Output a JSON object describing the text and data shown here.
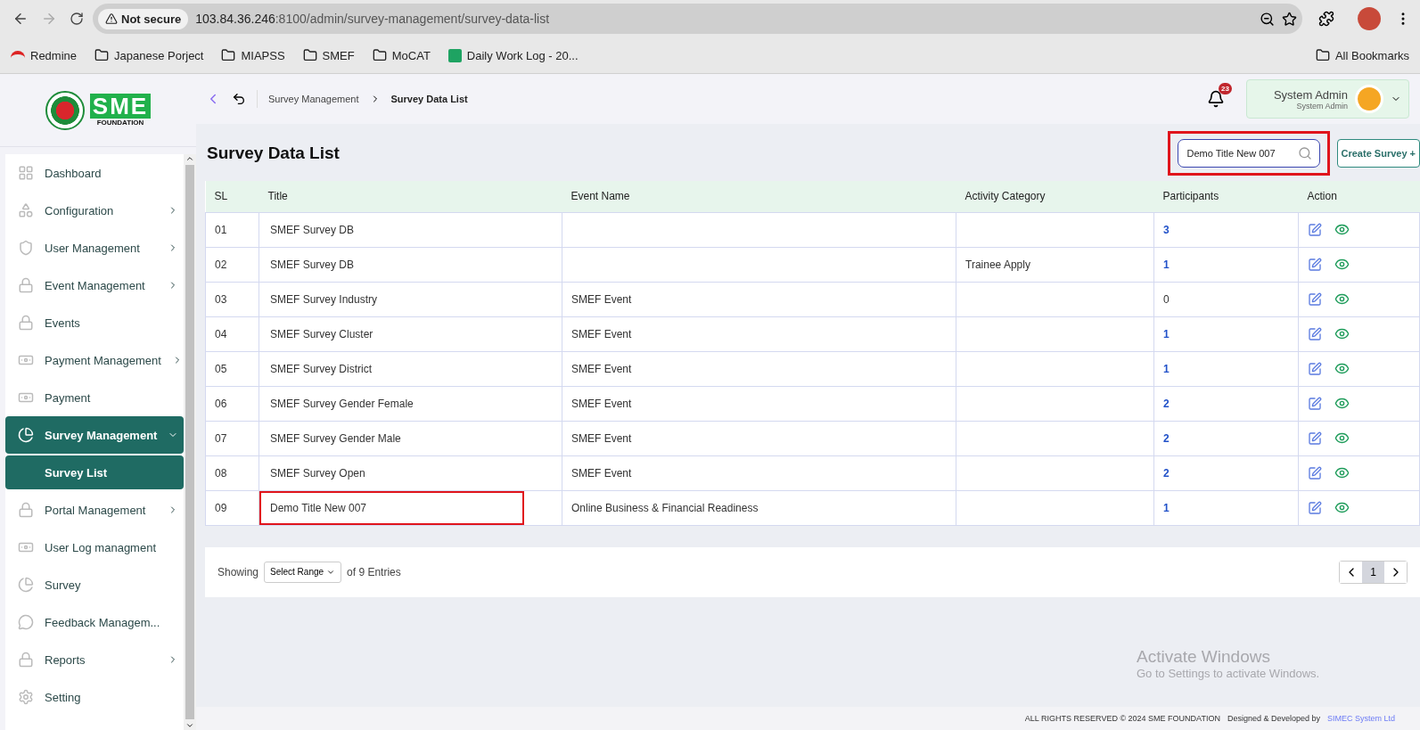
{
  "browser": {
    "security": "Not secure",
    "url_host": "103.84.36.246",
    "url_path": ":8100/admin/survey-management/survey-data-list",
    "bookmarks": [
      {
        "label": "Redmine",
        "kind": "site"
      },
      {
        "label": "Japanese Porject",
        "kind": "folder"
      },
      {
        "label": "MIAPSS",
        "kind": "folder"
      },
      {
        "label": "SMEF",
        "kind": "folder"
      },
      {
        "label": "MoCAT",
        "kind": "folder"
      },
      {
        "label": "Daily Work Log - 20...",
        "kind": "sheet"
      }
    ],
    "all_bookmarks": "All Bookmarks"
  },
  "logo": {
    "text": "SME",
    "subtitle": "FOUNDATION"
  },
  "breadcrumb": [
    {
      "label": "Survey Management",
      "current": false
    },
    {
      "label": "Survey Data List",
      "current": true
    }
  ],
  "notifications": {
    "count": "23"
  },
  "user": {
    "name": "System Admin",
    "role": "System Admin"
  },
  "sidebar": {
    "items": [
      {
        "label": "Dashboard",
        "has_submenu": false,
        "selected": false
      },
      {
        "label": "Configuration",
        "has_submenu": true,
        "selected": false,
        "expanded": false
      },
      {
        "label": "User Management",
        "has_submenu": true,
        "selected": false,
        "expanded": false
      },
      {
        "label": "Event Management",
        "has_submenu": true,
        "selected": false,
        "expanded": false
      },
      {
        "label": "Events",
        "has_submenu": false,
        "selected": false
      },
      {
        "label": "Payment Management",
        "has_submenu": true,
        "selected": false,
        "expanded": false
      },
      {
        "label": "Payment",
        "has_submenu": false,
        "selected": false
      },
      {
        "label": "Survey Management",
        "has_submenu": true,
        "selected": true,
        "expanded": true,
        "children": [
          {
            "label": "Survey List",
            "selected": true
          }
        ]
      },
      {
        "label": "Portal Management",
        "has_submenu": true,
        "selected": false,
        "expanded": false
      },
      {
        "label": "User Log managment",
        "has_submenu": false,
        "selected": false
      },
      {
        "label": "Survey",
        "has_submenu": false,
        "selected": false
      },
      {
        "label": "Feedback Managem...",
        "has_submenu": false,
        "selected": false
      },
      {
        "label": "Reports",
        "has_submenu": true,
        "selected": false,
        "expanded": false
      },
      {
        "label": "Setting",
        "has_submenu": false,
        "selected": false
      }
    ]
  },
  "page": {
    "title": "Survey Data List",
    "search": {
      "value": "Demo Title New 007",
      "highlighted": true
    },
    "create_button": "Create Survey +"
  },
  "table": {
    "columns": [
      "SL",
      "Title",
      "Event Name",
      "Activity Category",
      "Participants",
      "Action"
    ],
    "rows": [
      {
        "sl": "01",
        "title": "SMEF Survey DB",
        "event": "",
        "category": "",
        "participants": "3",
        "linked": true,
        "highlighted": false
      },
      {
        "sl": "02",
        "title": "SMEF Survey DB",
        "event": "",
        "category": "Trainee Apply",
        "participants": "1",
        "linked": true,
        "highlighted": false
      },
      {
        "sl": "03",
        "title": "SMEF Survey Industry",
        "event": "SMEF Event",
        "category": "",
        "participants": "0",
        "linked": false,
        "highlighted": false
      },
      {
        "sl": "04",
        "title": "SMEF Survey Cluster",
        "event": "SMEF Event",
        "category": "",
        "participants": "1",
        "linked": true,
        "highlighted": false
      },
      {
        "sl": "05",
        "title": "SMEF Survey District",
        "event": "SMEF Event",
        "category": "",
        "participants": "1",
        "linked": true,
        "highlighted": false
      },
      {
        "sl": "06",
        "title": "SMEF Survey Gender Female",
        "event": "SMEF Event",
        "category": "",
        "participants": "2",
        "linked": true,
        "highlighted": false
      },
      {
        "sl": "07",
        "title": "SMEF Survey Gender Male",
        "event": "SMEF Event",
        "category": "",
        "participants": "2",
        "linked": true,
        "highlighted": false
      },
      {
        "sl": "08",
        "title": "SMEF Survey Open",
        "event": "SMEF Event",
        "category": "",
        "participants": "2",
        "linked": true,
        "highlighted": false
      },
      {
        "sl": "09",
        "title": "Demo Title New 007",
        "event": "Online Business & Financial Readiness",
        "category": "",
        "participants": "1",
        "linked": true,
        "highlighted": true
      }
    ]
  },
  "pagination": {
    "showing": "Showing",
    "range": "Select Range",
    "entries": "of 9 Entries",
    "pages": [
      {
        "label": "1",
        "selected": true
      }
    ]
  },
  "os_notice": {
    "title": "Activate Windows",
    "text": "Go to Settings to activate Windows."
  },
  "footer": {
    "rights": "ALL RIGHTS RESERVED © 2024 SME FOUNDATION",
    "designed": "Designed & Developed by",
    "company": "SIMEC System Ltd"
  }
}
